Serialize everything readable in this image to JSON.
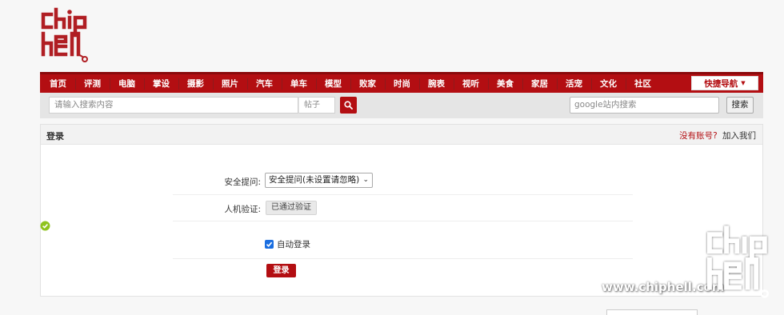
{
  "nav": {
    "items": [
      "首页",
      "评测",
      "电脑",
      "掌设",
      "摄影",
      "照片",
      "汽车",
      "单车",
      "模型",
      "败家",
      "时尚",
      "腕表",
      "视听",
      "美食",
      "家居",
      "活宠",
      "文化",
      "社区"
    ],
    "quick_nav": "快捷导航"
  },
  "search": {
    "placeholder": "请输入搜索内容",
    "type": "帖子",
    "google_placeholder": "google站内搜索",
    "google_button": "搜索"
  },
  "login": {
    "title": "登录",
    "no_account": "没有账号?",
    "join": "加入我们",
    "question_label": "安全提问:",
    "question_value": "安全提问(未设置请忽略)",
    "verify_label": "人机验证:",
    "verify_status": "已通过验证",
    "auto_login": "自动登录",
    "auto_login_checked": true,
    "submit": "登录"
  },
  "watermark": {
    "site": "www.chiphell.com"
  },
  "colors": {
    "brand_red": "#b30e12",
    "ok_green": "#8fc31f"
  }
}
